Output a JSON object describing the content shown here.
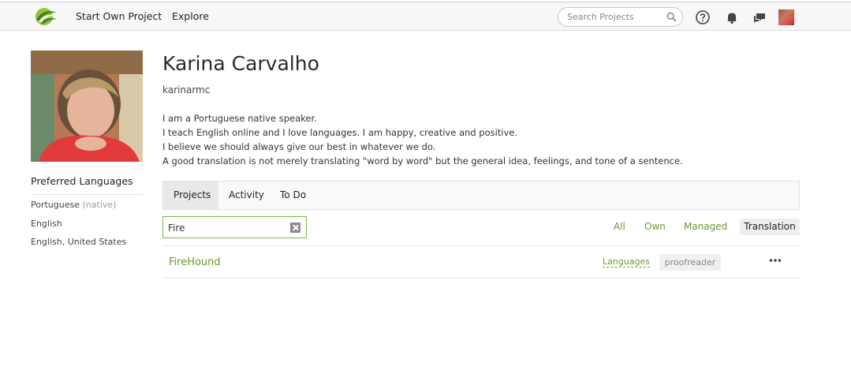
{
  "header": {
    "nav": {
      "start_project": "Start Own Project",
      "explore": "Explore"
    },
    "search": {
      "placeholder": "Search Projects",
      "value": ""
    },
    "icons": [
      "logo-icon",
      "search-icon",
      "help-icon",
      "bell-icon",
      "chat-icon",
      "avatar"
    ],
    "accent_color": "#6c9a32"
  },
  "profile": {
    "name": "Karina Carvalho",
    "username": "karinarmc",
    "bio": [
      "I am a Portuguese native speaker.",
      "I teach English online and I love languages. I am happy, creative and positive.",
      "I believe we should always give our best in whatever we do.",
      "A good translation is not merely translating \"word by word\" but the general idea, feelings, and tone of a sentence."
    ]
  },
  "preferred_languages": {
    "title": "Preferred Languages",
    "items": [
      {
        "name": "Portuguese",
        "note": "(native)"
      },
      {
        "name": "English",
        "note": ""
      },
      {
        "name": "English, United States",
        "note": ""
      }
    ]
  },
  "tabs": [
    {
      "label": "Projects",
      "active": true
    },
    {
      "label": "Activity",
      "active": false
    },
    {
      "label": "To Do",
      "active": false
    }
  ],
  "project_filter": {
    "value": "Fire",
    "links": [
      "All",
      "Own",
      "Managed",
      "Translation"
    ],
    "selected": "Translation"
  },
  "projects": [
    {
      "name": "FireHound",
      "languages_label": "Languages",
      "role": "proofreader"
    }
  ]
}
